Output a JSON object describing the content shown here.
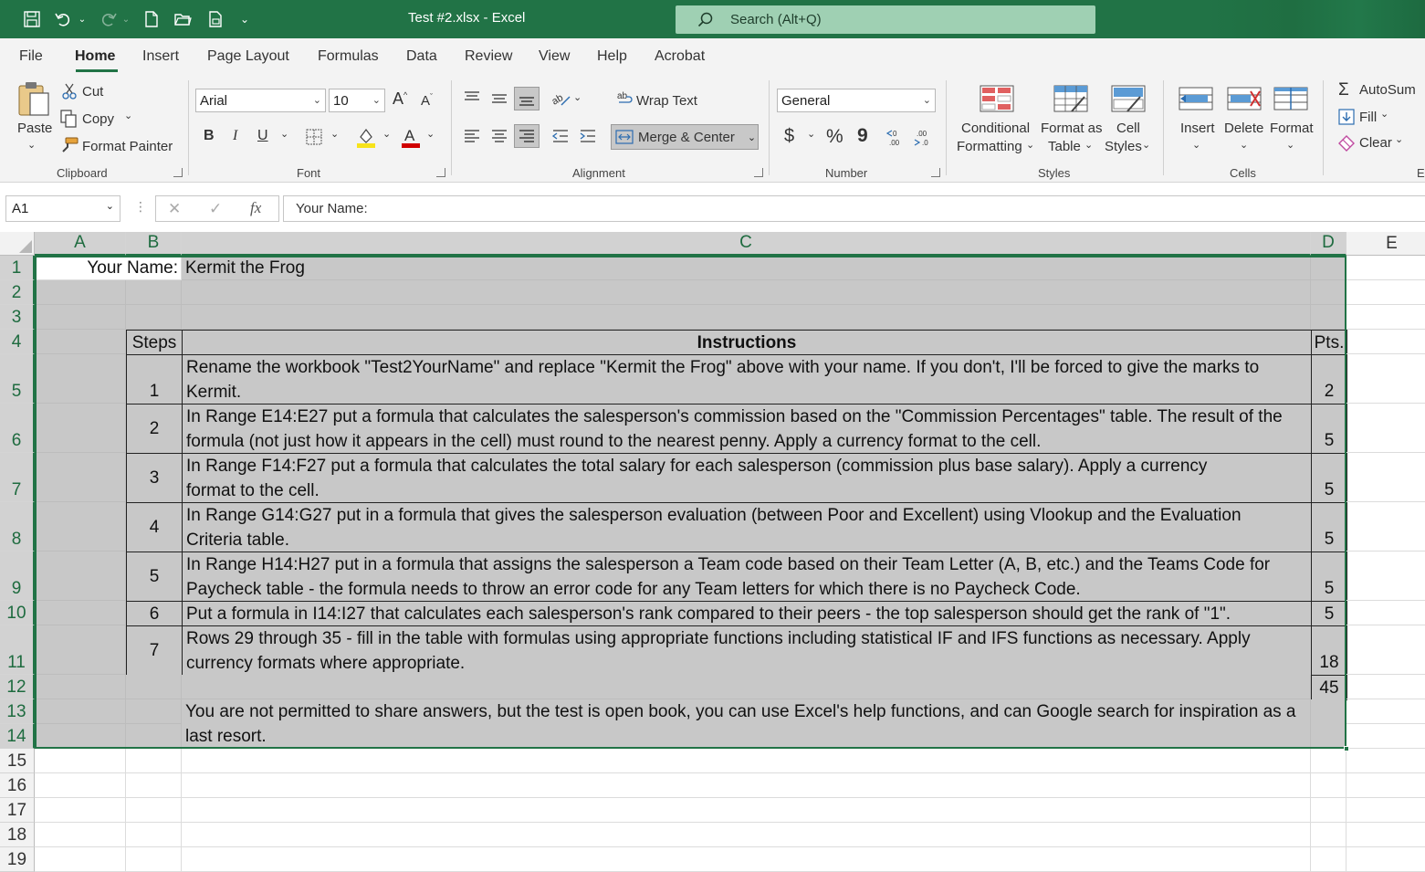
{
  "titlebar": {
    "doc_title": "Test #2.xlsx  -  Excel",
    "search_placeholder": "Search (Alt+Q)"
  },
  "menu": {
    "tabs": [
      "File",
      "Home",
      "Insert",
      "Page Layout",
      "Formulas",
      "Data",
      "Review",
      "View",
      "Help",
      "Acrobat"
    ],
    "active": "Home"
  },
  "ribbon": {
    "clipboard": {
      "paste": "Paste",
      "cut": "Cut",
      "copy": "Copy",
      "format_painter": "Format Painter",
      "label": "Clipboard"
    },
    "font": {
      "name": "Arial",
      "size": "10",
      "bold": "B",
      "italic": "I",
      "underline": "U",
      "label": "Font"
    },
    "alignment": {
      "wrap_text": "Wrap Text",
      "merge_center": "Merge & Center",
      "label": "Alignment"
    },
    "number": {
      "format": "General",
      "currency": "$",
      "percent": "%",
      "comma": "9",
      "label": "Number"
    },
    "styles": {
      "conditional_1": "Conditional",
      "conditional_2": "Formatting",
      "format_table_1": "Format as",
      "format_table_2": "Table",
      "cell_styles_1": "Cell",
      "cell_styles_2": "Styles",
      "label": "Styles"
    },
    "cells": {
      "insert": "Insert",
      "delete": "Delete",
      "format": "Format",
      "label": "Cells"
    },
    "editing": {
      "autosum": "AutoSum",
      "fill": "Fill",
      "clear": "Clear",
      "label_partial": "E"
    },
    "colors": {
      "accent": "#217346",
      "highlight": "#f7e31a",
      "font_color": "#d00000"
    }
  },
  "formula_bar": {
    "name_box": "A1",
    "cancel": "✕",
    "enter": "✓",
    "fx": "fx",
    "content": "Your Name:"
  },
  "grid": {
    "columns": [
      "A",
      "B",
      "C",
      "D",
      "E"
    ],
    "rows": [
      "1",
      "2",
      "3",
      "4",
      "5",
      "6",
      "7",
      "8",
      "9",
      "10",
      "11",
      "12",
      "13",
      "14",
      "15",
      "16",
      "17",
      "18",
      "19"
    ],
    "your_name_label": "Your Name:",
    "your_name_value": "Kermit the Frog",
    "header_steps": "Steps",
    "header_instructions": "Instructions",
    "header_pts": "Pts.",
    "steps": [
      {
        "num": "1",
        "text": "Rename the workbook \"Test2YourName\" and replace \"Kermit the Frog\" above with your name.  If you don't, I'll be forced to give the marks to Kermit.",
        "pts": "2"
      },
      {
        "num": "2",
        "text": "In Range E14:E27 put a formula that calculates the salesperson's commission based on the \"Commission Percentages\" table.  The result of the formula (not just how it appears in the cell) must round to the nearest penny.  Apply a currency format to the cell.",
        "pts": "5"
      },
      {
        "num": "3",
        "text": "In Range F14:F27 put a formula that calculates the total salary for each salesperson (commission plus base salary).  Apply a currency format to the cell.",
        "pts": "5"
      },
      {
        "num": "4",
        "text": "In Range G14:G27 put in a formula that gives the salesperson evaluation (between Poor and Excellent) using Vlookup and the Evaluation Criteria table.",
        "pts": "5"
      },
      {
        "num": "5",
        "text": "In Range H14:H27 put in a formula that assigns the salesperson a Team code based on their Team Letter (A, B, etc.) and the Teams Code for Paycheck table - the formula needs to throw an error code for any Team letters for which there is no Paycheck Code.",
        "pts": "5"
      },
      {
        "num": "6",
        "text": "Put a formula in I14:I27 that calculates each salesperson's rank compared to their peers - the top salesperson should get the rank of \"1\".",
        "pts": "5"
      },
      {
        "num": "7",
        "text": "Rows 29 through 35 - fill in the table with formulas using appropriate functions including statistical IF and IFS functions as necessary.  Apply currency formats where appropriate.",
        "pts": "18"
      }
    ],
    "total_pts": "45",
    "note": "You are not permitted to share answers, but the test is open book, you can use Excel's help functions, and can Google search for inspiration as a last resort."
  }
}
